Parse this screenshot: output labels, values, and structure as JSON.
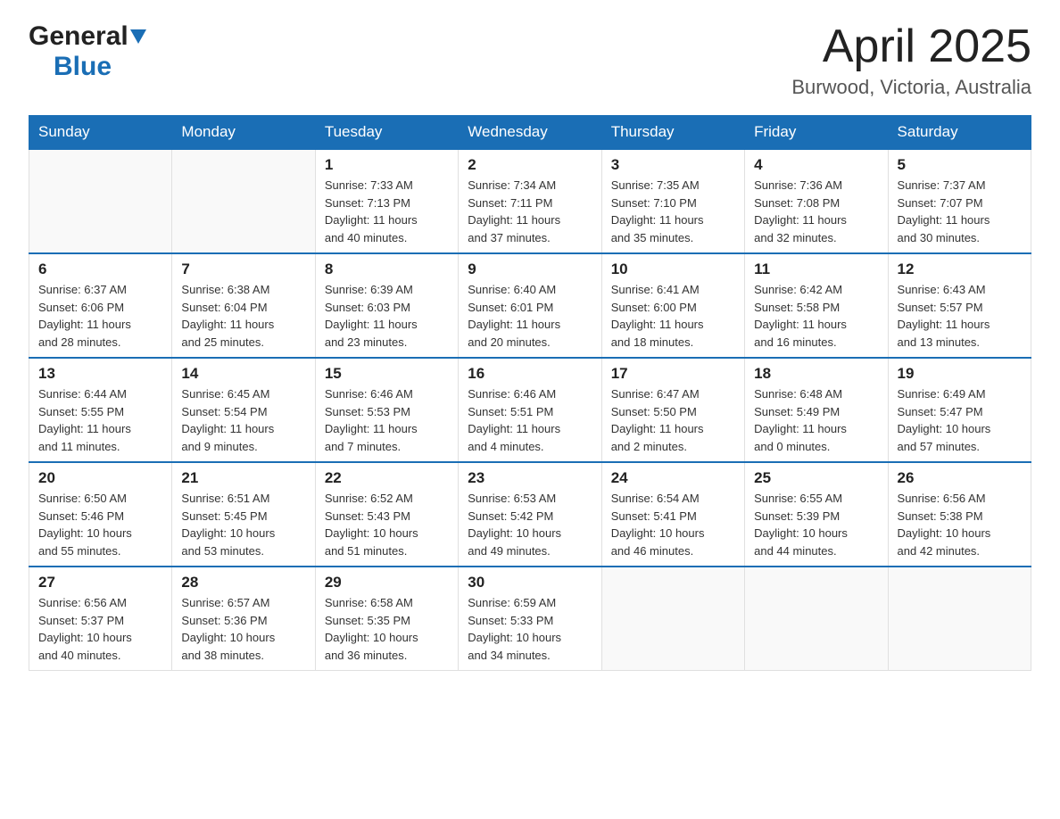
{
  "header": {
    "logo_general": "General",
    "logo_blue": "Blue",
    "title": "April 2025",
    "location": "Burwood, Victoria, Australia"
  },
  "weekdays": [
    "Sunday",
    "Monday",
    "Tuesday",
    "Wednesday",
    "Thursday",
    "Friday",
    "Saturday"
  ],
  "weeks": [
    [
      {
        "day": "",
        "info": ""
      },
      {
        "day": "",
        "info": ""
      },
      {
        "day": "1",
        "info": "Sunrise: 7:33 AM\nSunset: 7:13 PM\nDaylight: 11 hours\nand 40 minutes."
      },
      {
        "day": "2",
        "info": "Sunrise: 7:34 AM\nSunset: 7:11 PM\nDaylight: 11 hours\nand 37 minutes."
      },
      {
        "day": "3",
        "info": "Sunrise: 7:35 AM\nSunset: 7:10 PM\nDaylight: 11 hours\nand 35 minutes."
      },
      {
        "day": "4",
        "info": "Sunrise: 7:36 AM\nSunset: 7:08 PM\nDaylight: 11 hours\nand 32 minutes."
      },
      {
        "day": "5",
        "info": "Sunrise: 7:37 AM\nSunset: 7:07 PM\nDaylight: 11 hours\nand 30 minutes."
      }
    ],
    [
      {
        "day": "6",
        "info": "Sunrise: 6:37 AM\nSunset: 6:06 PM\nDaylight: 11 hours\nand 28 minutes."
      },
      {
        "day": "7",
        "info": "Sunrise: 6:38 AM\nSunset: 6:04 PM\nDaylight: 11 hours\nand 25 minutes."
      },
      {
        "day": "8",
        "info": "Sunrise: 6:39 AM\nSunset: 6:03 PM\nDaylight: 11 hours\nand 23 minutes."
      },
      {
        "day": "9",
        "info": "Sunrise: 6:40 AM\nSunset: 6:01 PM\nDaylight: 11 hours\nand 20 minutes."
      },
      {
        "day": "10",
        "info": "Sunrise: 6:41 AM\nSunset: 6:00 PM\nDaylight: 11 hours\nand 18 minutes."
      },
      {
        "day": "11",
        "info": "Sunrise: 6:42 AM\nSunset: 5:58 PM\nDaylight: 11 hours\nand 16 minutes."
      },
      {
        "day": "12",
        "info": "Sunrise: 6:43 AM\nSunset: 5:57 PM\nDaylight: 11 hours\nand 13 minutes."
      }
    ],
    [
      {
        "day": "13",
        "info": "Sunrise: 6:44 AM\nSunset: 5:55 PM\nDaylight: 11 hours\nand 11 minutes."
      },
      {
        "day": "14",
        "info": "Sunrise: 6:45 AM\nSunset: 5:54 PM\nDaylight: 11 hours\nand 9 minutes."
      },
      {
        "day": "15",
        "info": "Sunrise: 6:46 AM\nSunset: 5:53 PM\nDaylight: 11 hours\nand 7 minutes."
      },
      {
        "day": "16",
        "info": "Sunrise: 6:46 AM\nSunset: 5:51 PM\nDaylight: 11 hours\nand 4 minutes."
      },
      {
        "day": "17",
        "info": "Sunrise: 6:47 AM\nSunset: 5:50 PM\nDaylight: 11 hours\nand 2 minutes."
      },
      {
        "day": "18",
        "info": "Sunrise: 6:48 AM\nSunset: 5:49 PM\nDaylight: 11 hours\nand 0 minutes."
      },
      {
        "day": "19",
        "info": "Sunrise: 6:49 AM\nSunset: 5:47 PM\nDaylight: 10 hours\nand 57 minutes."
      }
    ],
    [
      {
        "day": "20",
        "info": "Sunrise: 6:50 AM\nSunset: 5:46 PM\nDaylight: 10 hours\nand 55 minutes."
      },
      {
        "day": "21",
        "info": "Sunrise: 6:51 AM\nSunset: 5:45 PM\nDaylight: 10 hours\nand 53 minutes."
      },
      {
        "day": "22",
        "info": "Sunrise: 6:52 AM\nSunset: 5:43 PM\nDaylight: 10 hours\nand 51 minutes."
      },
      {
        "day": "23",
        "info": "Sunrise: 6:53 AM\nSunset: 5:42 PM\nDaylight: 10 hours\nand 49 minutes."
      },
      {
        "day": "24",
        "info": "Sunrise: 6:54 AM\nSunset: 5:41 PM\nDaylight: 10 hours\nand 46 minutes."
      },
      {
        "day": "25",
        "info": "Sunrise: 6:55 AM\nSunset: 5:39 PM\nDaylight: 10 hours\nand 44 minutes."
      },
      {
        "day": "26",
        "info": "Sunrise: 6:56 AM\nSunset: 5:38 PM\nDaylight: 10 hours\nand 42 minutes."
      }
    ],
    [
      {
        "day": "27",
        "info": "Sunrise: 6:56 AM\nSunset: 5:37 PM\nDaylight: 10 hours\nand 40 minutes."
      },
      {
        "day": "28",
        "info": "Sunrise: 6:57 AM\nSunset: 5:36 PM\nDaylight: 10 hours\nand 38 minutes."
      },
      {
        "day": "29",
        "info": "Sunrise: 6:58 AM\nSunset: 5:35 PM\nDaylight: 10 hours\nand 36 minutes."
      },
      {
        "day": "30",
        "info": "Sunrise: 6:59 AM\nSunset: 5:33 PM\nDaylight: 10 hours\nand 34 minutes."
      },
      {
        "day": "",
        "info": ""
      },
      {
        "day": "",
        "info": ""
      },
      {
        "day": "",
        "info": ""
      }
    ]
  ]
}
